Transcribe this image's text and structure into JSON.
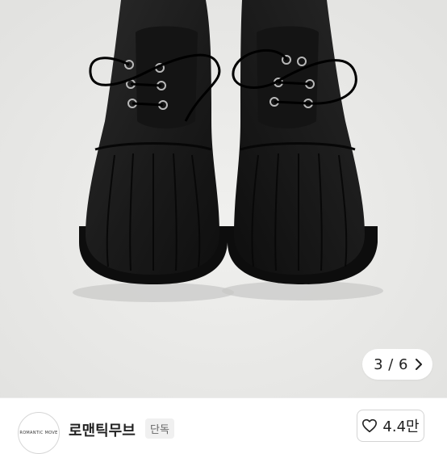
{
  "gallery": {
    "image_alt": "black leather duck-toe lace-up shoes",
    "counter": "3 / 6"
  },
  "shop": {
    "logo_text": "ROMANTIC MOVE",
    "name": "로맨틱무브",
    "badge": "단독"
  },
  "like": {
    "count": "4.4만"
  },
  "icons": {
    "next": "chevron-right-icon",
    "like": "heart-outline-icon"
  },
  "colors": {
    "photo_background": "#e9e9e7",
    "shoe": "#1b1b1b"
  }
}
